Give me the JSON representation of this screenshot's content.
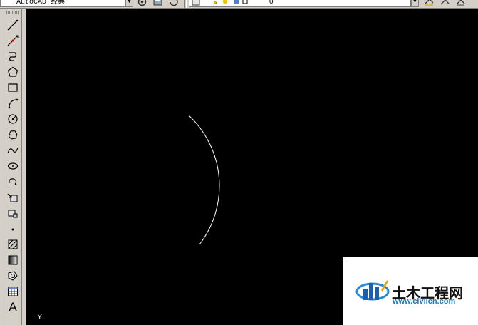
{
  "top_toolbar": {
    "workspace_name": "AutoCAD 经典",
    "layer_name": "0"
  },
  "left_toolbar": {
    "tools": [
      {
        "name": "line-tool-icon"
      },
      {
        "name": "construction-line-tool-icon"
      },
      {
        "name": "polyline-tool-icon"
      },
      {
        "name": "polygon-tool-icon"
      },
      {
        "name": "rectangle-tool-icon"
      },
      {
        "name": "arc-tool-icon"
      },
      {
        "name": "circle-tool-icon"
      },
      {
        "name": "revision-cloud-tool-icon"
      },
      {
        "name": "spline-tool-icon"
      },
      {
        "name": "ellipse-tool-icon"
      },
      {
        "name": "ellipse-arc-tool-icon"
      },
      {
        "name": "insert-block-tool-icon"
      },
      {
        "name": "make-block-tool-icon"
      },
      {
        "name": "point-tool-icon"
      },
      {
        "name": "hatch-tool-icon"
      },
      {
        "name": "gradient-tool-icon"
      },
      {
        "name": "region-tool-icon"
      },
      {
        "name": "table-tool-icon"
      },
      {
        "name": "multiline-text-tool-icon",
        "label": "A"
      }
    ]
  },
  "canvas": {
    "background": "#000000",
    "stroke_color": "#ffffff",
    "ucs_label": "Y"
  },
  "watermark": {
    "brand": "土木工程网",
    "url": "www.civilcn.com"
  }
}
